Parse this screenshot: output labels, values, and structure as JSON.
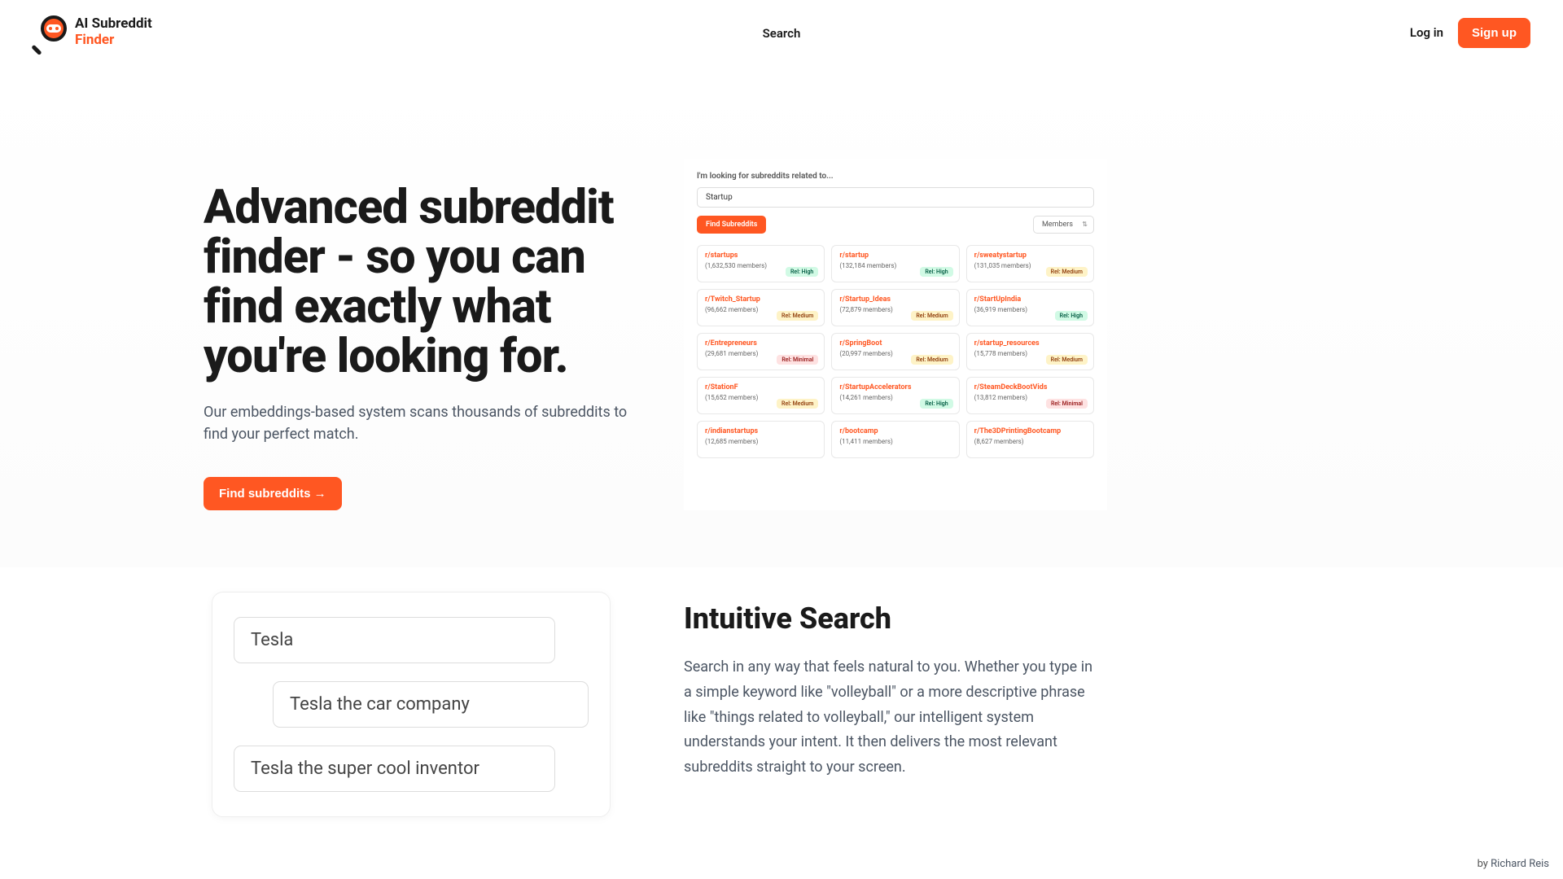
{
  "header": {
    "logo_line1": "AI Subreddit",
    "logo_line2": "Finder",
    "nav_search": "Search",
    "login": "Log in",
    "signup": "Sign up"
  },
  "hero": {
    "title": "Advanced subreddit finder - so you can find exactly what you're looking for.",
    "description": "Our embeddings-based system scans thousands of subreddits to find your perfect match.",
    "cta_label": "Find subreddits →"
  },
  "demo": {
    "prompt_label": "I'm looking for subreddits related to...",
    "input_value": "Startup",
    "find_btn": "Find Subreddits",
    "sort_label": "Members",
    "cards": [
      {
        "name": "r/startups",
        "members": "(1,632,530 members)",
        "rel": "Rel: High",
        "badge": "high"
      },
      {
        "name": "r/startup",
        "members": "(132,184 members)",
        "rel": "Rel: High",
        "badge": "high"
      },
      {
        "name": "r/sweatystartup",
        "members": "(131,035 members)",
        "rel": "Rel: Medium",
        "badge": "medium"
      },
      {
        "name": "r/Twitch_Startup",
        "members": "(96,662 members)",
        "rel": "Rel: Medium",
        "badge": "medium"
      },
      {
        "name": "r/Startup_Ideas",
        "members": "(72,879 members)",
        "rel": "Rel: Medium",
        "badge": "medium"
      },
      {
        "name": "r/StartUpIndia",
        "members": "(36,919 members)",
        "rel": "Rel: High",
        "badge": "high"
      },
      {
        "name": "r/Entrepreneurs",
        "members": "(29,681 members)",
        "rel": "Rel: Minimal",
        "badge": "minimal"
      },
      {
        "name": "r/SpringBoot",
        "members": "(20,997 members)",
        "rel": "Rel: Medium",
        "badge": "medium"
      },
      {
        "name": "r/startup_resources",
        "members": "(15,778 members)",
        "rel": "Rel: Medium",
        "badge": "medium"
      },
      {
        "name": "r/StationF",
        "members": "(15,652 members)",
        "rel": "Rel: Medium",
        "badge": "medium"
      },
      {
        "name": "r/StartupAccelerators",
        "members": "(14,261 members)",
        "rel": "Rel: High",
        "badge": "high"
      },
      {
        "name": "r/SteamDeckBootVids",
        "members": "(13,812 members)",
        "rel": "Rel: Minimal",
        "badge": "minimal"
      },
      {
        "name": "r/indianstartups",
        "members": "(12,685 members)",
        "rel": "",
        "badge": ""
      },
      {
        "name": "r/bootcamp",
        "members": "(11,411 members)",
        "rel": "",
        "badge": ""
      },
      {
        "name": "r/The3DPrintingBootcamp",
        "members": "(8,627 members)",
        "rel": "",
        "badge": ""
      }
    ]
  },
  "feature": {
    "title": "Intuitive Search",
    "text": "Search in any way that feels natural to you. Whether you type in a simple keyword like \"volleyball\" or a more descriptive phrase like \"things related to volleyball,\" our intelligent system understands your intent. It then delivers the most relevant subreddits straight to your screen.",
    "chips": [
      "Tesla",
      "Tesla the car company",
      "Tesla the super cool inventor"
    ]
  },
  "credit": {
    "prefix": "by ",
    "name": "Richard Reis"
  }
}
